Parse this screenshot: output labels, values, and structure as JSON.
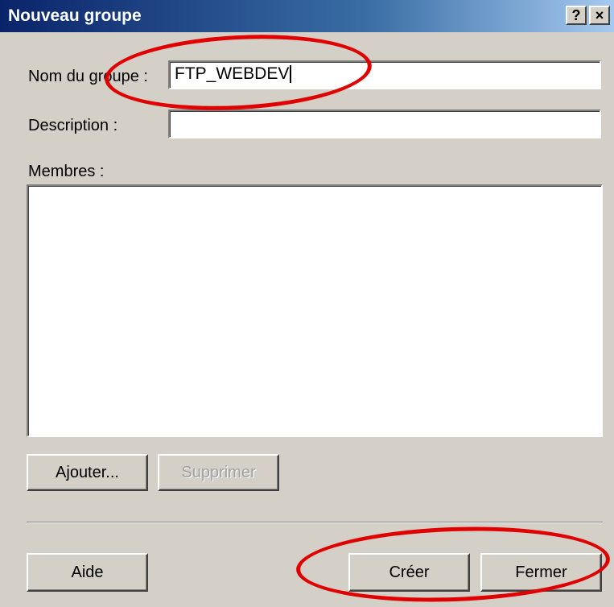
{
  "window": {
    "title": "Nouveau groupe",
    "help_button": "?",
    "close_button": "×"
  },
  "form": {
    "name_label": "Nom du groupe :",
    "name_value": "FTP_WEBDEV",
    "description_label": "Description :",
    "description_value": "",
    "members_label": "Membres :",
    "members": []
  },
  "buttons": {
    "add": "Ajouter...",
    "remove": "Supprimer",
    "help": "Aide",
    "create": "Créer",
    "close": "Fermer"
  },
  "colors": {
    "annotation": "#e00000",
    "dialog_bg": "#d4d0c8",
    "titlebar": "#0a246a"
  }
}
